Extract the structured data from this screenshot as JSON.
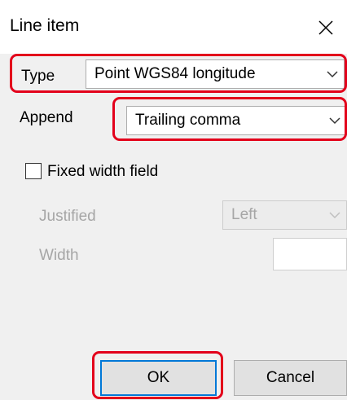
{
  "window": {
    "title": "Line item"
  },
  "type_field": {
    "label": "Type",
    "value": "Point WGS84 longitude"
  },
  "append_field": {
    "label": "Append",
    "value": "Trailing comma"
  },
  "fixed_width": {
    "label": "Fixed width field",
    "checked": false
  },
  "justified_field": {
    "label": "Justified",
    "value": "Left"
  },
  "width_field": {
    "label": "Width",
    "value": ""
  },
  "buttons": {
    "ok": "OK",
    "cancel": "Cancel"
  },
  "colors": {
    "highlight": "#e3001b",
    "default_button_border": "#0078d7",
    "dialog_background": "#f0f0f0"
  }
}
